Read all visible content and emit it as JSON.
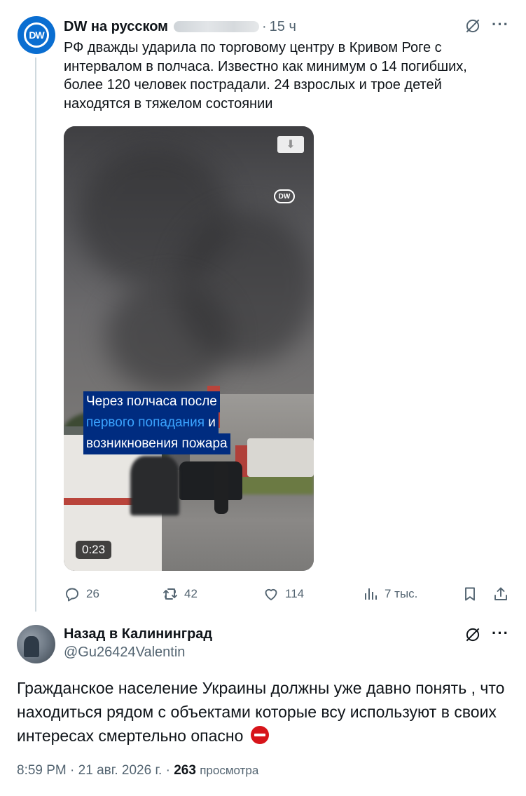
{
  "tweet1": {
    "author_name": "DW на русском",
    "time_ago": "15 ч",
    "text": "РФ дважды ударила по торговому центру в Кривом Роге с интервалом в полчаса. Известно как минимум о 14 погибших, более 120 человек пострадали. 24 взрослых и трое детей находятся в тяжелом состоянии",
    "avatar_text": "DW",
    "video": {
      "watermark": "DW",
      "caption_line1": "Через полчаса после",
      "caption_line2_highlight": "первого попадания",
      "caption_line2_rest": " и",
      "caption_line3": "возникновения пожара",
      "duration": "0:23"
    },
    "stats": {
      "replies": "26",
      "reposts": "42",
      "likes": "114",
      "views": "7 тыс."
    }
  },
  "tweet2": {
    "author_name": "Назад в Калининград",
    "handle": "@Gu26424Valentin",
    "text": "Гражданское население Украины должны уже давно понять , что находиться рядом с объектами которые всу используют в своих интересах смертельно опасно",
    "time": "8:59 PM",
    "date": "21 авг. 2026 г.",
    "views_count": "263",
    "views_label": "просмотра"
  },
  "icons": {
    "more": "more-icon",
    "grok": "grok-icon",
    "reply": "reply-icon",
    "repost": "repost-icon",
    "like": "heart-icon",
    "views": "views-icon",
    "bookmark": "bookmark-icon",
    "share": "share-icon",
    "download": "download-icon",
    "no_entry": "no-entry-icon"
  },
  "colors": {
    "text": "#0f1419",
    "secondary": "#536471",
    "caption_bg": "#002c80",
    "caption_highlight": "#3aa3ff",
    "dw_blue": "#0a6ed1"
  }
}
